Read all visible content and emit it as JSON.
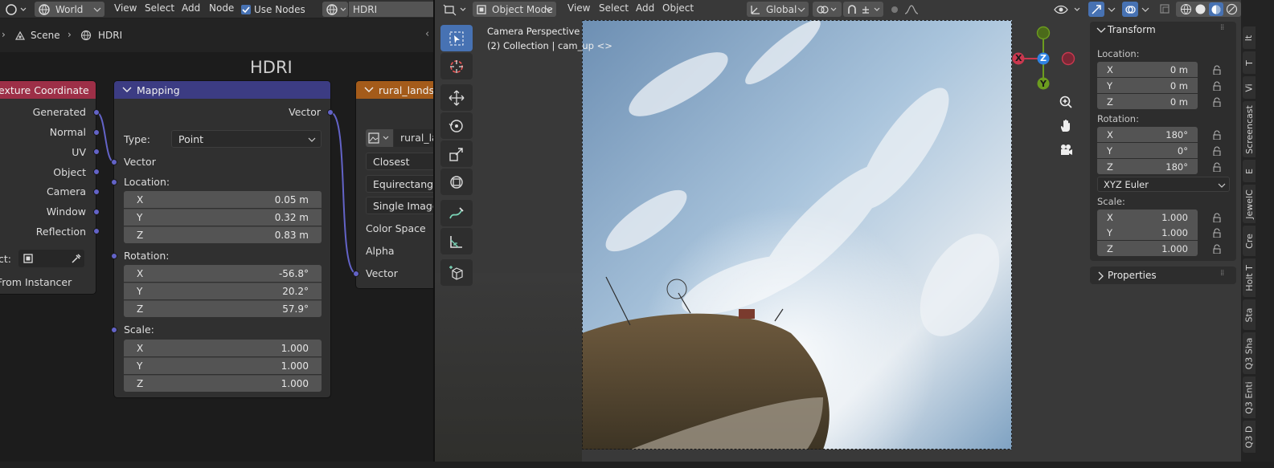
{
  "node_header": {
    "world_label": "World",
    "menus": [
      "View",
      "Select",
      "Add",
      "Node"
    ],
    "use_nodes_label": "Use Nodes",
    "world_name": "HDRI"
  },
  "breadcrumb": {
    "scene": "Scene",
    "world": "HDRI"
  },
  "frame_label": "HDRI",
  "tex_coord_node": {
    "title": "exture Coordinate",
    "outputs": [
      "Generated",
      "Normal",
      "UV",
      "Object",
      "Camera",
      "Window",
      "Reflection"
    ],
    "object_label": "ct:",
    "from_instancer": "From Instancer"
  },
  "mapping_node": {
    "title": "Mapping",
    "output": "Vector",
    "type_label": "Type:",
    "type_value": "Point",
    "vector_label": "Vector",
    "location_label": "Location:",
    "location": [
      [
        "X",
        "0.05 m"
      ],
      [
        "Y",
        "0.32 m"
      ],
      [
        "Z",
        "0.83 m"
      ]
    ],
    "rotation_label": "Rotation:",
    "rotation": [
      [
        "X",
        "-56.8°"
      ],
      [
        "Y",
        "20.2°"
      ],
      [
        "Z",
        "57.9°"
      ]
    ],
    "scale_label": "Scale:",
    "scale": [
      [
        "X",
        "1.000"
      ],
      [
        "Y",
        "1.000"
      ],
      [
        "Z",
        "1.000"
      ]
    ]
  },
  "env_node": {
    "title": "rural_landsc",
    "image_name": "rural_la",
    "interpolation": "Closest",
    "projection": "Equirectangul",
    "source": "Single Image",
    "color_space": "Color Space",
    "alpha": "Alpha",
    "vector": "Vector"
  },
  "viewport_header": {
    "mode": "Object Mode",
    "menus": [
      "View",
      "Select",
      "Add",
      "Object"
    ],
    "orientation": "Global"
  },
  "viewport_info": {
    "line1": "Camera Perspective",
    "line2": "(2) Collection | cam_up <>"
  },
  "gizmo": {
    "x": "X",
    "y": "Y",
    "z": "Z"
  },
  "transform_panel": {
    "title": "Transform",
    "location_label": "Location:",
    "location": [
      [
        "X",
        "0 m"
      ],
      [
        "Y",
        "0 m"
      ],
      [
        "Z",
        "0 m"
      ]
    ],
    "rotation_label": "Rotation:",
    "rotation": [
      [
        "X",
        "180°"
      ],
      [
        "Y",
        "0°"
      ],
      [
        "Z",
        "180°"
      ]
    ],
    "rotation_mode": "XYZ Euler",
    "scale_label": "Scale:",
    "scale": [
      [
        "X",
        "1.000"
      ],
      [
        "Y",
        "1.000"
      ],
      [
        "Z",
        "1.000"
      ]
    ]
  },
  "properties_panel": {
    "title": "Properties"
  },
  "side_tabs": [
    "lt",
    "T",
    "Vi",
    "Screencast",
    "E",
    "JewelC",
    "Cre",
    "Holt T",
    "Sta",
    "Q3 Sha",
    "Q3 Enti",
    "Q3 D"
  ],
  "colors": {
    "accent": "#4772b3",
    "node_texcoord_header": "#9d2f47",
    "node_mapping_header": "#3c3c83",
    "node_texture_header": "#a45b1a",
    "socket_vector": "#6363c7",
    "axis_x": "#c9384f",
    "axis_y": "#6c9c1f",
    "axis_z": "#2f83e3"
  }
}
